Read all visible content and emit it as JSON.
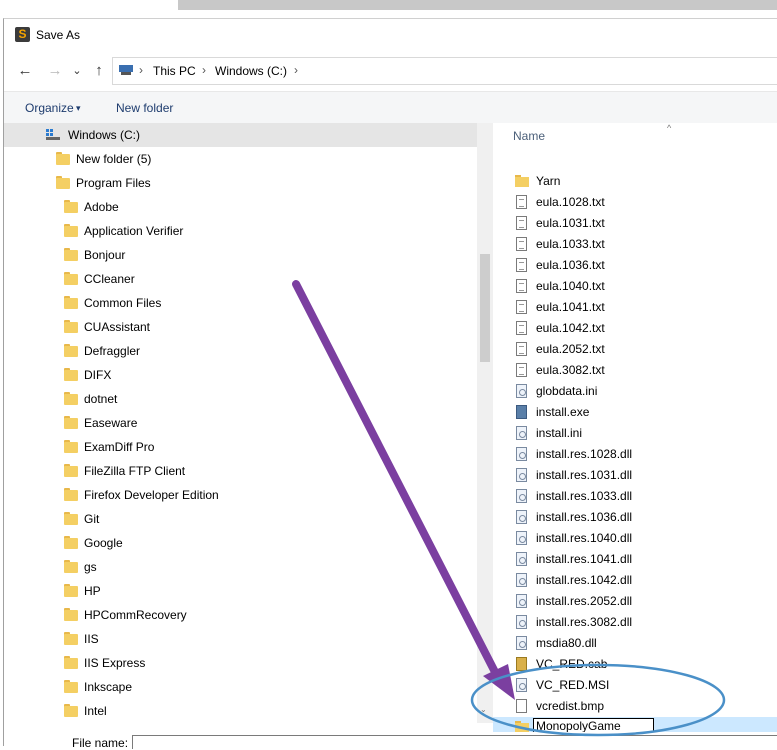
{
  "dialog": {
    "title": "Save As",
    "app_icon": "sublime-text-icon"
  },
  "nav": {
    "back": "←",
    "forward": "→",
    "recent": "⌄",
    "up": "↑",
    "breadcrumbs": [
      "This PC",
      "Windows (C:)"
    ],
    "sep": "›"
  },
  "toolbar": {
    "organize": "Organize",
    "organize_caret": "▾",
    "new_folder": "New folder"
  },
  "tree": {
    "root": "Windows (C:)",
    "items": [
      {
        "label": "New folder (5)",
        "level": 1
      },
      {
        "label": "Program Files",
        "level": 1
      },
      {
        "label": "Adobe",
        "level": 2
      },
      {
        "label": "Application Verifier",
        "level": 2
      },
      {
        "label": "Bonjour",
        "level": 2
      },
      {
        "label": "CCleaner",
        "level": 2
      },
      {
        "label": "Common Files",
        "level": 2
      },
      {
        "label": "CUAssistant",
        "level": 2
      },
      {
        "label": "Defraggler",
        "level": 2
      },
      {
        "label": "DIFX",
        "level": 2
      },
      {
        "label": "dotnet",
        "level": 2
      },
      {
        "label": "Easeware",
        "level": 2
      },
      {
        "label": "ExamDiff Pro",
        "level": 2
      },
      {
        "label": "FileZilla FTP Client",
        "level": 2
      },
      {
        "label": "Firefox Developer Edition",
        "level": 2
      },
      {
        "label": "Git",
        "level": 2
      },
      {
        "label": "Google",
        "level": 2
      },
      {
        "label": "gs",
        "level": 2
      },
      {
        "label": "HP",
        "level": 2
      },
      {
        "label": "HPCommRecovery",
        "level": 2
      },
      {
        "label": "IIS",
        "level": 2
      },
      {
        "label": "IIS Express",
        "level": 2
      },
      {
        "label": "Inkscape",
        "level": 2
      },
      {
        "label": "Intel",
        "level": 2
      }
    ]
  },
  "files": {
    "column_header": "Name",
    "sort_indicator": "^",
    "items": [
      {
        "name": "Yarn",
        "icon": "folder-icon"
      },
      {
        "name": "eula.1028.txt",
        "icon": "text-file-icon"
      },
      {
        "name": "eula.1031.txt",
        "icon": "text-file-icon"
      },
      {
        "name": "eula.1033.txt",
        "icon": "text-file-icon"
      },
      {
        "name": "eula.1036.txt",
        "icon": "text-file-icon"
      },
      {
        "name": "eula.1040.txt",
        "icon": "text-file-icon"
      },
      {
        "name": "eula.1041.txt",
        "icon": "text-file-icon"
      },
      {
        "name": "eula.1042.txt",
        "icon": "text-file-icon"
      },
      {
        "name": "eula.2052.txt",
        "icon": "text-file-icon"
      },
      {
        "name": "eula.3082.txt",
        "icon": "text-file-icon"
      },
      {
        "name": "globdata.ini",
        "icon": "settings-file-icon"
      },
      {
        "name": "install.exe",
        "icon": "exe-file-icon"
      },
      {
        "name": "install.ini",
        "icon": "settings-file-icon"
      },
      {
        "name": "install.res.1028.dll",
        "icon": "dll-file-icon"
      },
      {
        "name": "install.res.1031.dll",
        "icon": "dll-file-icon"
      },
      {
        "name": "install.res.1033.dll",
        "icon": "dll-file-icon"
      },
      {
        "name": "install.res.1036.dll",
        "icon": "dll-file-icon"
      },
      {
        "name": "install.res.1040.dll",
        "icon": "dll-file-icon"
      },
      {
        "name": "install.res.1041.dll",
        "icon": "dll-file-icon"
      },
      {
        "name": "install.res.1042.dll",
        "icon": "dll-file-icon"
      },
      {
        "name": "install.res.2052.dll",
        "icon": "dll-file-icon"
      },
      {
        "name": "install.res.3082.dll",
        "icon": "dll-file-icon"
      },
      {
        "name": "msdia80.dll",
        "icon": "dll-file-icon"
      },
      {
        "name": "VC_RED.cab",
        "icon": "cab-file-icon"
      },
      {
        "name": "VC_RED.MSI",
        "icon": "msi-file-icon"
      },
      {
        "name": "vcredist.bmp",
        "icon": "bmp-file-icon"
      }
    ],
    "new_folder_name": "MonopolyGame"
  },
  "footer": {
    "file_name_label": "File name:"
  },
  "annotation": {
    "arrow_color": "#7b3fa0",
    "ellipse_color": "#4a90c8"
  }
}
